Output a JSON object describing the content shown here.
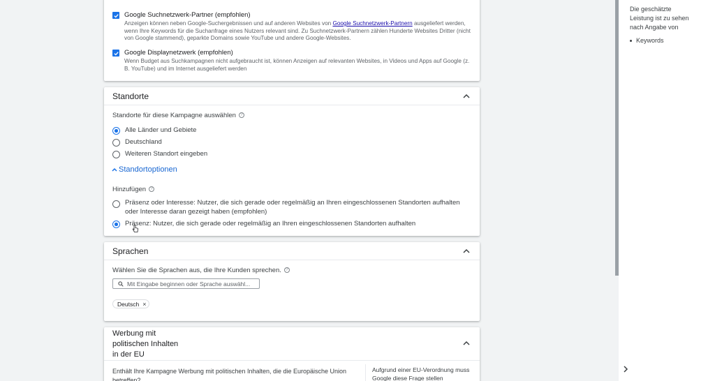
{
  "network": {
    "search_partner_title": "Google Suchnetzwerk-Partner (empfohlen)",
    "search_partner_desc_1": "Anzeigen können neben Google-Suchergebnissen und auf anderen Websites von ",
    "search_partner_link": "Google Suchnetzwerk-Partnern",
    "search_partner_desc_2": " ausgeliefert werden, wenn Ihre Keywords für die Suchanfrage eines Nutzers relevant sind. Zu Suchnetzwerk-Partnern zählen Hunderte Websites Dritter (nicht von Google stammend), geparkte Domains sowie YouTube und andere Google-Websites.",
    "display_title": "Google Displaynetzwerk (empfohlen)",
    "display_desc": "Wenn Budget aus Suchkampagnen nicht aufgebraucht ist, können Anzeigen auf relevanten Websites, in Videos und Apps auf Google (z. B. YouTube) und im Internet ausgeliefert werden"
  },
  "locations": {
    "title": "Standorte",
    "select_label": "Standorte für diese Kampagne auswählen",
    "options": [
      "Alle Länder und Gebiete",
      "Deutschland",
      "Weiteren Standort eingeben"
    ],
    "selected_index": 0,
    "options_toggle": "Standortoptionen",
    "add_label": "Hinzufügen",
    "add_options": [
      "Präsenz oder Interesse: Nutzer, die sich gerade oder regelmäßig an Ihren eingeschlossenen Standorten aufhalten oder Interesse daran gezeigt haben (empfohlen)",
      "Präsenz: Nutzer, die sich gerade oder regelmäßig an Ihren eingeschlossenen Standorten aufhalten"
    ],
    "add_selected_index": 1
  },
  "languages": {
    "title": "Sprachen",
    "select_label": "Wählen Sie die Sprachen aus, die Ihre Kunden sprechen.",
    "search_placeholder": "Mit Eingabe beginnen oder Sprache auswähl...",
    "chip": "Deutsch"
  },
  "political": {
    "title_1": "Werbung mit",
    "title_2": "politischen Inhalten",
    "title_3": "in der EU",
    "question": "Enthält Ihre Kampagne Werbung mit politischen Inhalten, die die Europäische Union betreffen?",
    "note": "Aufgrund einer EU-Verordnung muss Google diese Frage stellen"
  },
  "sidebar": {
    "text": "Die geschätzte Leistung ist zu sehen nach Angabe von",
    "items": [
      "Keywords"
    ]
  },
  "colors": {
    "accent": "#1a73e8",
    "link": "#1a0dab"
  },
  "icons": [
    "check-icon",
    "chevron-up-icon",
    "help-icon",
    "search-icon",
    "close-icon",
    "chevron-right-icon",
    "hand-cursor-icon"
  ]
}
